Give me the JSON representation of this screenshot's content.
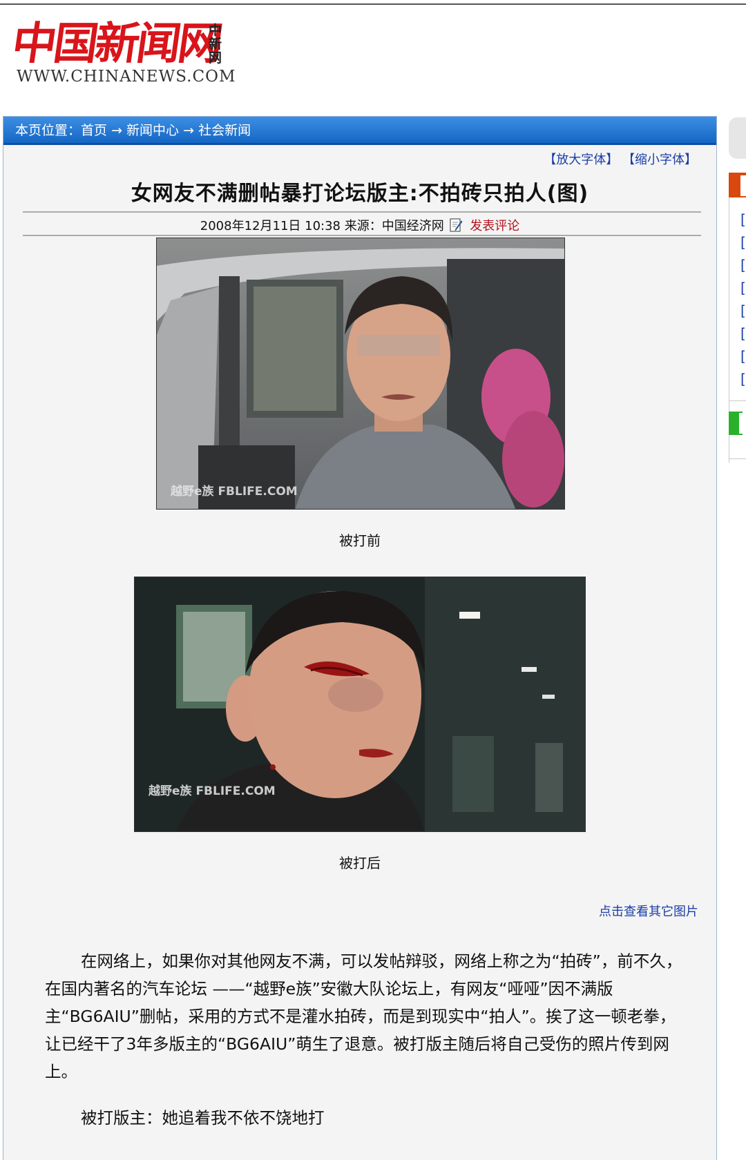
{
  "site": {
    "logo_text": "中国新闻网",
    "logo_side": "中新网",
    "url": "WWW.CHINANEWS.COM"
  },
  "breadcrumb": {
    "label": "本页位置：",
    "items": [
      "首页",
      "新闻中心",
      "社会新闻"
    ],
    "separator": "→"
  },
  "font_controls": {
    "enlarge": "【放大字体】",
    "shrink": "【缩小字体】"
  },
  "article": {
    "title": "女网友不满删帖暴打论坛版主:不拍砖只拍人(图)",
    "date": "2008年12月11日 10:38",
    "source_label": "来源：",
    "source": "中国经济网",
    "comment_link": "发表评论",
    "photo1": {
      "watermark": "越野e族 FBLIFE.COM",
      "caption": "被打前"
    },
    "photo2": {
      "watermark": "越野e族 FBLIFE.COM",
      "caption": "被打后"
    },
    "more_pictures": "点击查看其它图片",
    "paragraph1": "在网络上，如果你对其他网友不满，可以发帖辩驳，网络上称之为“拍砖”，前不久，在国内著名的汽车论坛 ——“越野e族”安徽大队论坛上，有网友“哑哑”因不满版主“BG6AIU”删帖，采用的方式不是灌水拍砖，而是到现实中“拍人”。挨了这一顿老拳，让已经干了3年多版主的“BG6AIU”萌生了退意。被打版主随后将自己受伤的照片传到网上。",
    "paragraph2": "被打版主：她追着我不依不饶地打"
  },
  "sidebar": {
    "brackets": [
      "[",
      "[",
      "[",
      "[",
      "[",
      "[",
      "[",
      "["
    ]
  },
  "colors": {
    "logo_red": "#d8151b",
    "nav_blue": "#1466c4",
    "link_blue": "#1a3ea6",
    "comment_red": "#b5121b",
    "sidebar_orange": "#d9480f",
    "sidebar_green": "#2bb02b"
  },
  "icons": {
    "comment": "pencil-icon"
  }
}
